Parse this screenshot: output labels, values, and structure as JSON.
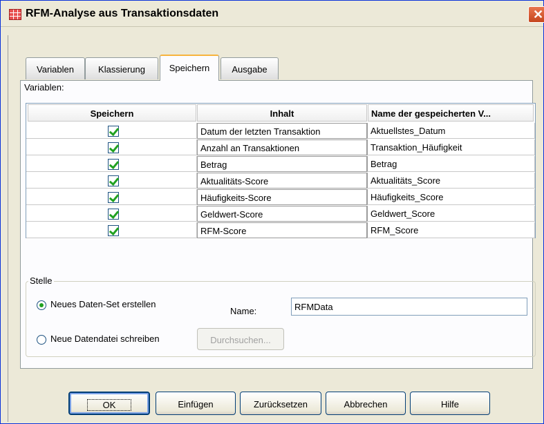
{
  "window": {
    "title": "RFM-Analyse aus Transaktionsdaten",
    "close_glyph": "✕"
  },
  "tabs": [
    {
      "label": "Variablen",
      "active": false
    },
    {
      "label": "Klassierung",
      "active": false
    },
    {
      "label": "Speichern",
      "active": true
    },
    {
      "label": "Ausgabe",
      "active": false
    }
  ],
  "variables_label": "Variablen:",
  "table": {
    "headers": [
      "Speichern",
      "Inhalt",
      "Name der gespeicherten V..."
    ],
    "rows": [
      {
        "checked": true,
        "content": "Datum der letzten Transaktion",
        "name": "Aktuellstes_Datum"
      },
      {
        "checked": true,
        "content": "Anzahl an Transaktionen",
        "name": "Transaktion_Häufigkeit"
      },
      {
        "checked": true,
        "content": "Betrag",
        "name": "Betrag"
      },
      {
        "checked": true,
        "content": "Aktualitäts-Score",
        "name": "Aktualitäts_Score"
      },
      {
        "checked": true,
        "content": "Häufigkeits-Score",
        "name": "Häufigkeits_Score"
      },
      {
        "checked": true,
        "content": "Geldwert-Score",
        "name": "Geldwert_Score"
      },
      {
        "checked": true,
        "content": "RFM-Score",
        "name": "RFM_Score"
      }
    ]
  },
  "location": {
    "legend": "Stelle",
    "option_new_dataset": "Neues Daten-Set erstellen",
    "option_new_file": "Neue Datendatei schreiben",
    "selected": "new_dataset",
    "name_label": "Name:",
    "name_value": "RFMData",
    "browse_label": "Durchsuchen..."
  },
  "buttons": {
    "ok": "OK",
    "paste": "Einfügen",
    "reset": "Zurücksetzen",
    "cancel": "Abbrechen",
    "help": "Hilfe"
  },
  "colors": {
    "checkmark": "#21a121",
    "active_tab_accent": "#f7b43c",
    "dialog_bg": "#ece9d8"
  }
}
